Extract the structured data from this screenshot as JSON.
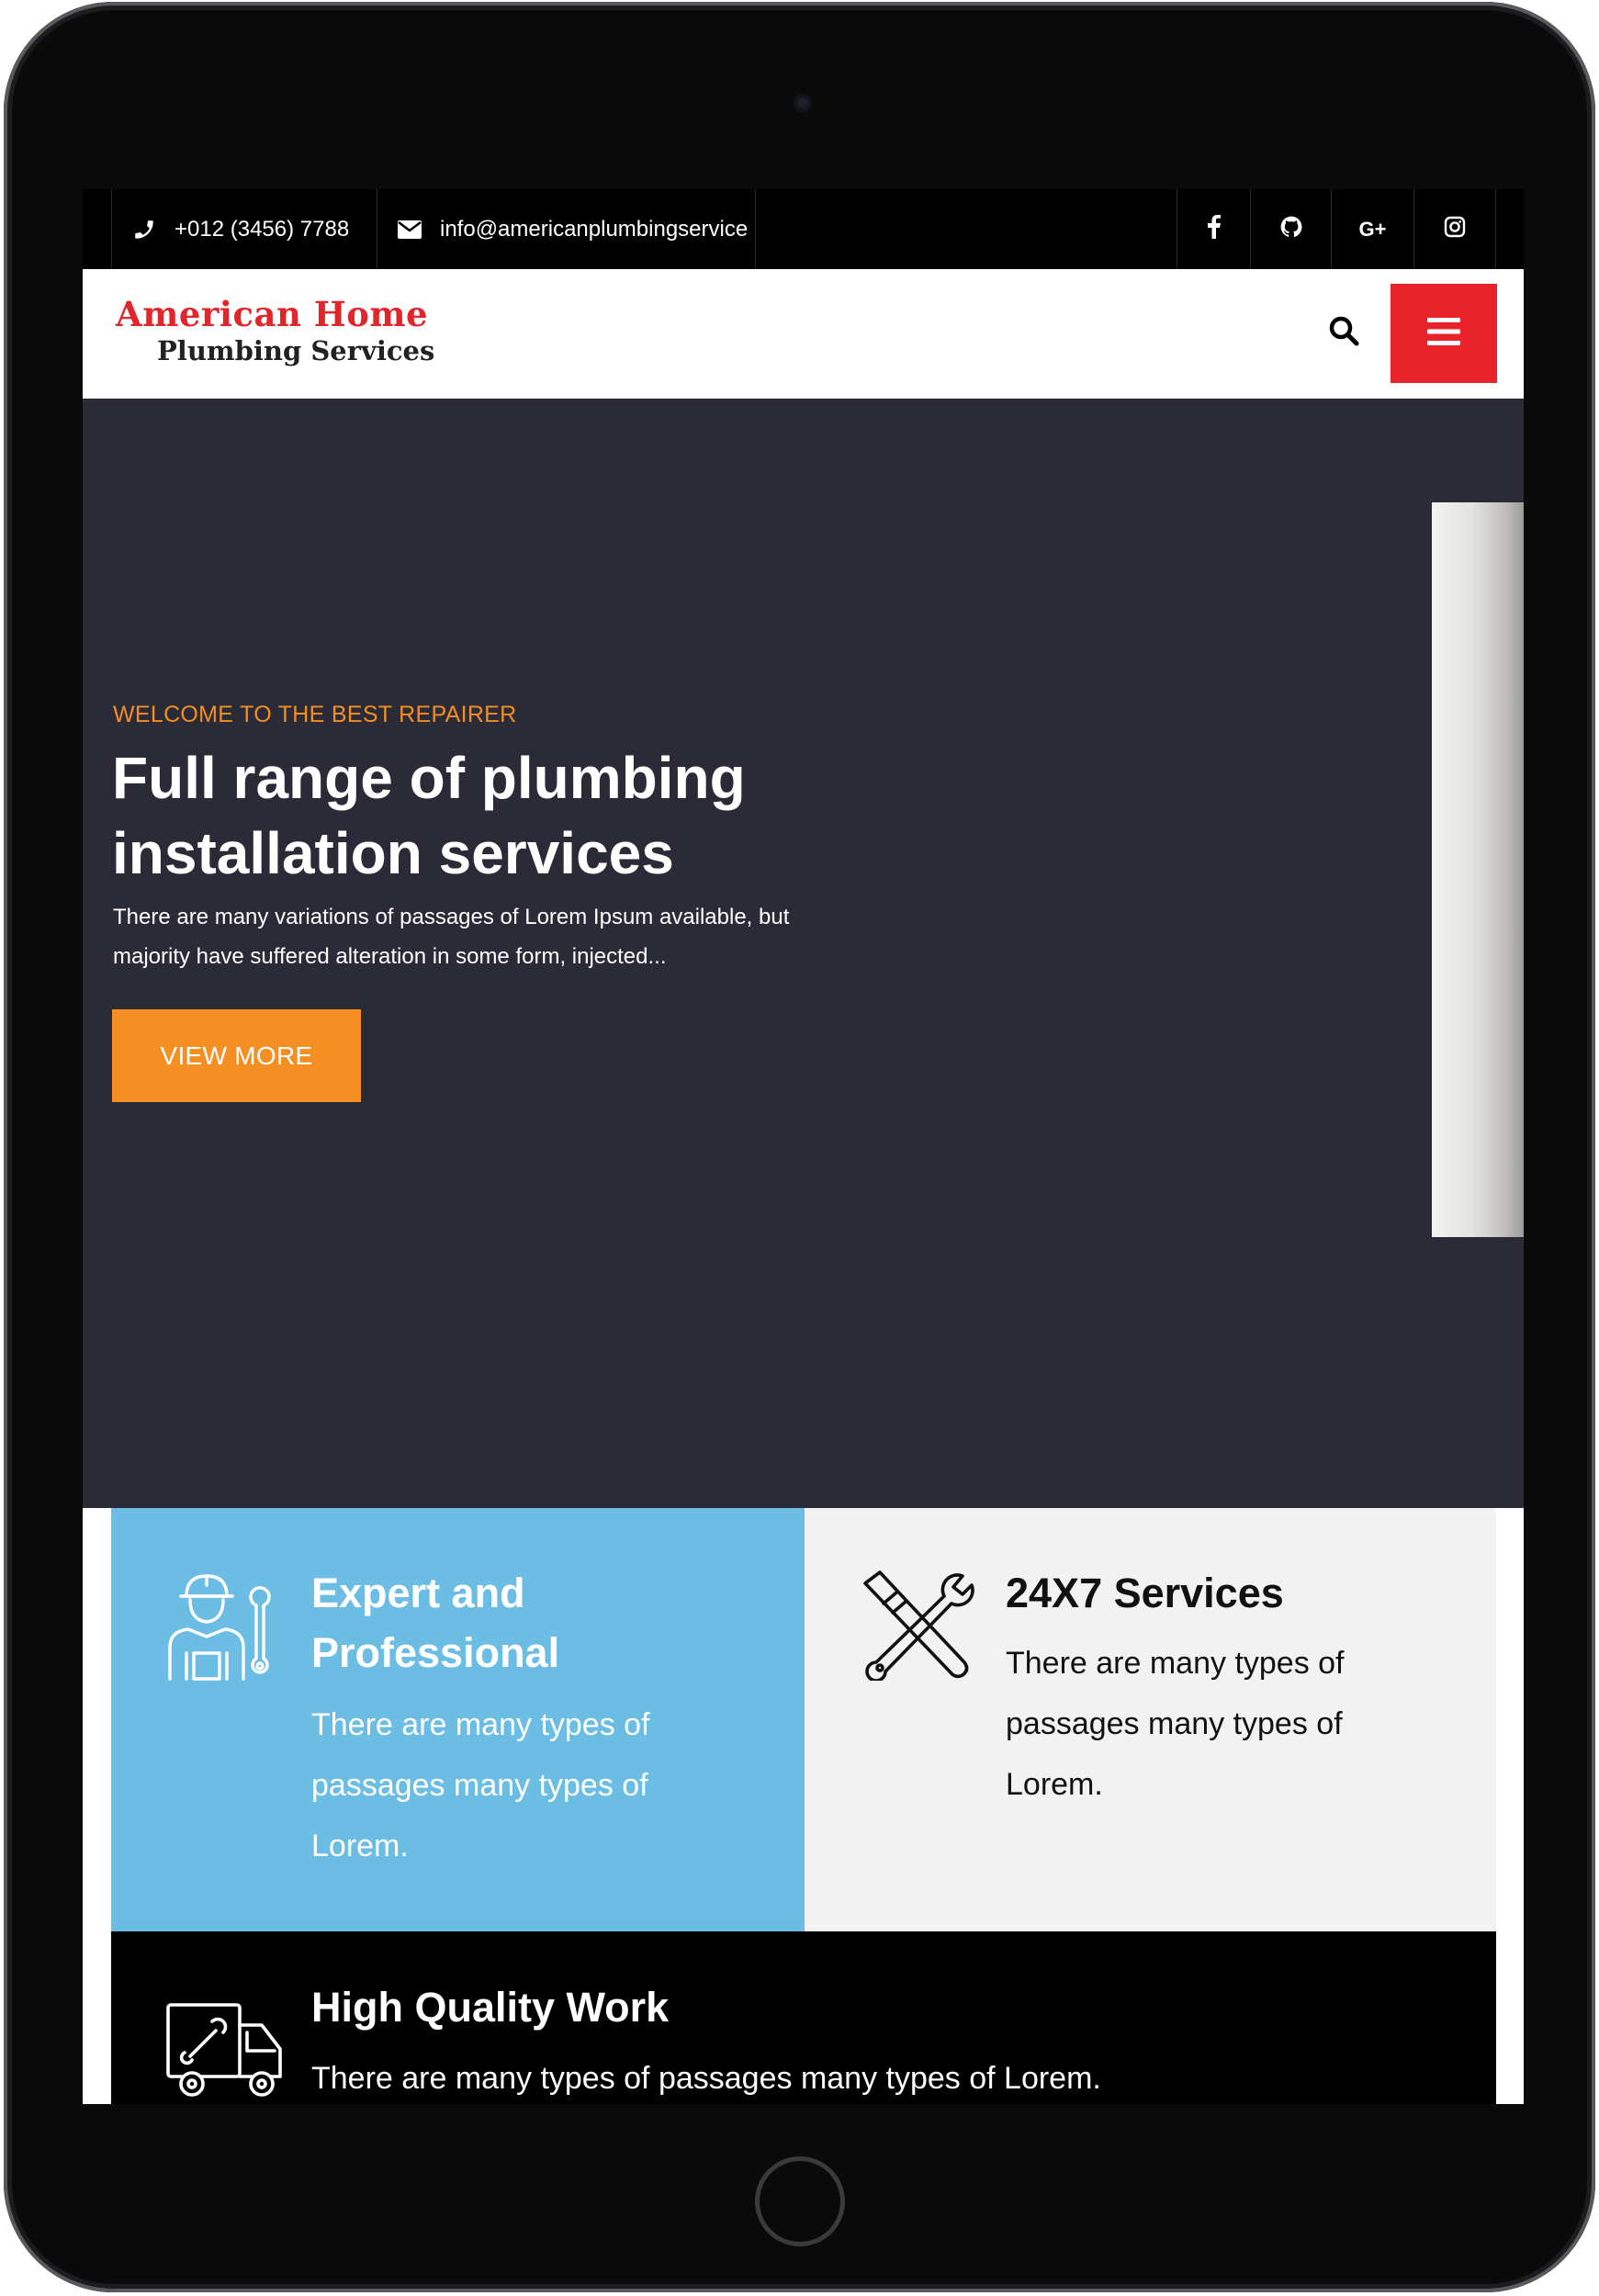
{
  "topbar": {
    "phone": "+012 (3456) 7788",
    "email": "info@americanplumbingservice",
    "social": [
      {
        "icon": "facebook-icon",
        "label": "f"
      },
      {
        "icon": "github-icon",
        "label": ""
      },
      {
        "icon": "google-plus-icon",
        "label": "G+"
      },
      {
        "icon": "instagram-icon",
        "label": ""
      }
    ]
  },
  "header": {
    "logo_line1": "American Home",
    "logo_line2": "Plumbing Services",
    "search_icon": "search-icon",
    "menu_icon": "hamburger-menu-icon"
  },
  "hero": {
    "eyebrow": "WELCOME TO THE BEST REPAIRER",
    "title": "Full range of plumbing installation services",
    "description": "There are many variations of passages of Lorem Ipsum available, but majority have suffered alteration in some form, injected...",
    "cta": "VIEW MORE"
  },
  "features": [
    {
      "title": "Expert and Professional",
      "text": "There are many types of passages many types of Lorem.",
      "icon": "plumber-worker-icon"
    },
    {
      "title": "24X7 Services",
      "text": "There are many types of passages many types of Lorem.",
      "icon": "wrench-tools-icon"
    },
    {
      "title": "High Quality Work",
      "text": "There are many types of passages many types of Lorem.",
      "icon": "service-truck-icon"
    }
  ],
  "colors": {
    "accent_orange": "#f58f22",
    "brand_red": "#e8232a",
    "hero_bg": "#2a2b37",
    "feature_blue": "#6bbde3"
  }
}
